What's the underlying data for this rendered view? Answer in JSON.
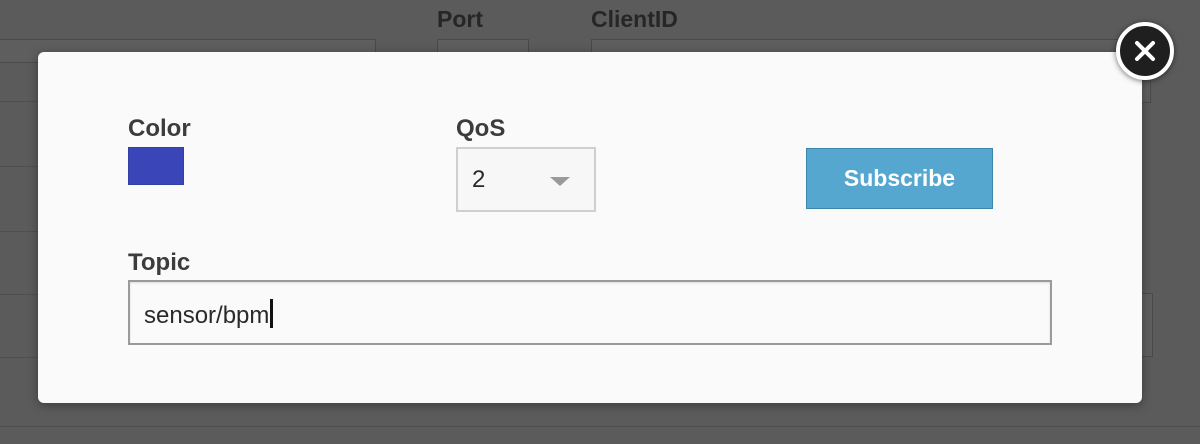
{
  "background": {
    "port_label": "Port",
    "clientid_label": "ClientID"
  },
  "modal": {
    "color_label": "Color",
    "color_value": "#3a46b8",
    "qos_label": "QoS",
    "qos_selected": "2",
    "subscribe_label": "Subscribe",
    "subscribe_color": "#55a7cf",
    "topic_label": "Topic",
    "topic_value": "sensor/bpm"
  },
  "icons": {
    "close": "close-icon",
    "qos_dropdown": "chevron-down-icon"
  }
}
